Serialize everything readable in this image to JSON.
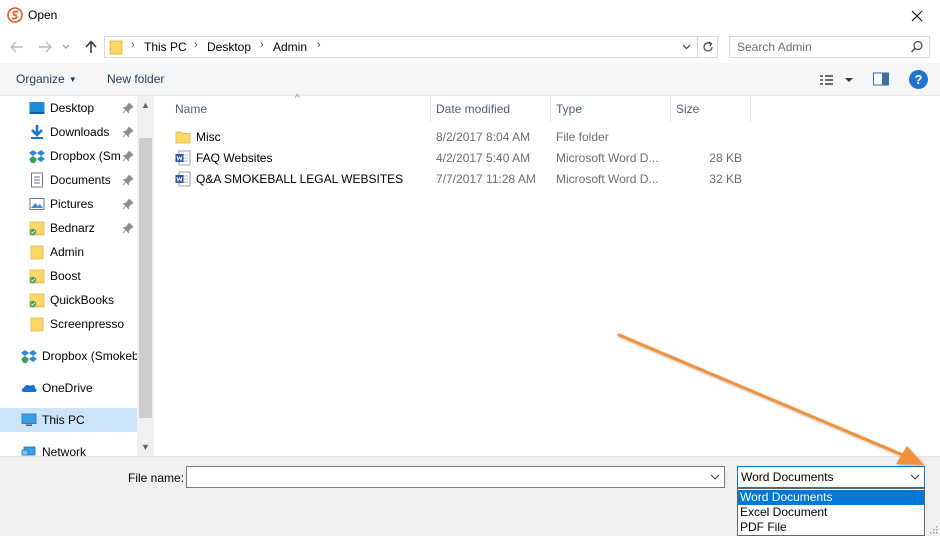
{
  "window": {
    "title": "Open",
    "accent_color": "#0078d7",
    "selection_color": "#cce4f7"
  },
  "address": {
    "crumbs": [
      "This PC",
      "Desktop",
      "Admin"
    ],
    "search_placeholder": "Search Admin"
  },
  "toolbar": {
    "organize_label": "Organize",
    "new_folder_label": "New folder",
    "help_label": "?"
  },
  "nav": {
    "items": [
      {
        "label": "Desktop",
        "icon": "desktop-icon",
        "pinned": true
      },
      {
        "label": "Downloads",
        "icon": "downloads-icon",
        "pinned": true
      },
      {
        "label": "Dropbox (Sm",
        "icon": "dropbox-icon",
        "pinned": true
      },
      {
        "label": "Documents",
        "icon": "documents-icon",
        "pinned": true
      },
      {
        "label": "Pictures",
        "icon": "pictures-icon",
        "pinned": true
      },
      {
        "label": "Bednarz",
        "icon": "synced-folder-icon",
        "pinned": true
      },
      {
        "label": "Admin",
        "icon": "folder-icon",
        "pinned": false
      },
      {
        "label": "Boost",
        "icon": "synced-folder-icon",
        "pinned": false
      },
      {
        "label": "QuickBooks",
        "icon": "synced-folder-icon",
        "pinned": false
      },
      {
        "label": "Screenpresso",
        "icon": "folder-icon",
        "pinned": false
      }
    ],
    "roots": [
      {
        "label": "Dropbox (Smokeb",
        "icon": "dropbox-icon"
      },
      {
        "label": "OneDrive",
        "icon": "onedrive-icon"
      },
      {
        "label": "This PC",
        "icon": "this-pc-icon"
      },
      {
        "label": "Network",
        "icon": "network-icon"
      }
    ]
  },
  "columns": {
    "name": "Name",
    "date": "Date modified",
    "type": "Type",
    "size": "Size"
  },
  "files": [
    {
      "name": "Misc",
      "date": "8/2/2017 8:04 AM",
      "type": "File folder",
      "size": "",
      "icon": "folder-icon"
    },
    {
      "name": "FAQ Websites",
      "date": "4/2/2017 5:40 AM",
      "type": "Microsoft Word D...",
      "size": "28 KB",
      "icon": "word-doc-icon"
    },
    {
      "name": "Q&A SMOKEBALL LEGAL WEBSITES",
      "date": "7/7/2017 11:28 AM",
      "type": "Microsoft Word D...",
      "size": "32 KB",
      "icon": "word-doc-icon"
    }
  ],
  "footer": {
    "file_name_label": "File name:",
    "file_name_value": "",
    "file_type_selected": "Word Documents",
    "file_type_options": [
      "Word Documents",
      "Excel Document",
      "PDF File"
    ]
  },
  "annotation": {
    "arrow_color": "#f0913a"
  }
}
